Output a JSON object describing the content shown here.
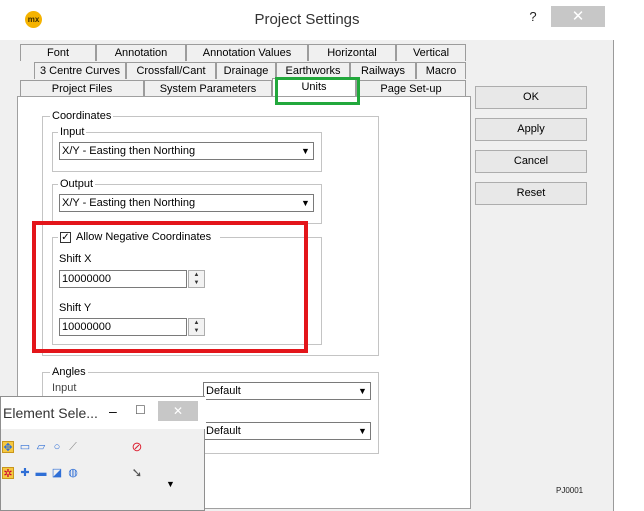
{
  "window": {
    "logo": "mx",
    "title": "Project Settings",
    "help": "?",
    "close": "✕"
  },
  "tabs": {
    "row1": [
      "Font",
      "Annotation",
      "Annotation Values",
      "Horizontal",
      "Vertical"
    ],
    "row2": [
      "3 Centre Curves",
      "Crossfall/Cant",
      "Drainage",
      "Earthworks",
      "Railways",
      "Macro"
    ],
    "row3": [
      "Project Files",
      "System Parameters",
      "Units",
      "Page Set-up"
    ],
    "active": "Units"
  },
  "buttons": {
    "ok": "OK",
    "apply": "Apply",
    "cancel": "Cancel",
    "reset": "Reset"
  },
  "coordinates": {
    "label": "Coordinates",
    "input_label": "Input",
    "input_value": "X/Y - Easting then Northing",
    "output_label": "Output",
    "output_value": "X/Y - Easting then Northing",
    "allow_negative_label": "Allow Negative Coordinates",
    "allow_negative_checked": "✓",
    "shift_x_label": "Shift X",
    "shift_x_value": "10000000",
    "shift_y_label": "Shift Y",
    "shift_y_value": "10000000"
  },
  "angles": {
    "label": "Angles",
    "input_label": "Input",
    "input_value": "Default",
    "output_value": "Default"
  },
  "page_code": "PJ0001",
  "palette": {
    "title": "Element Sele...",
    "minimize": "–",
    "maximize": "☐",
    "close": "✕"
  },
  "icons": {
    "dropdown": "chevron-down-icon",
    "spin": "spin-arrows-icon"
  },
  "colors": {
    "highlight_red": "#e3151a",
    "highlight_green": "#22a83c"
  }
}
